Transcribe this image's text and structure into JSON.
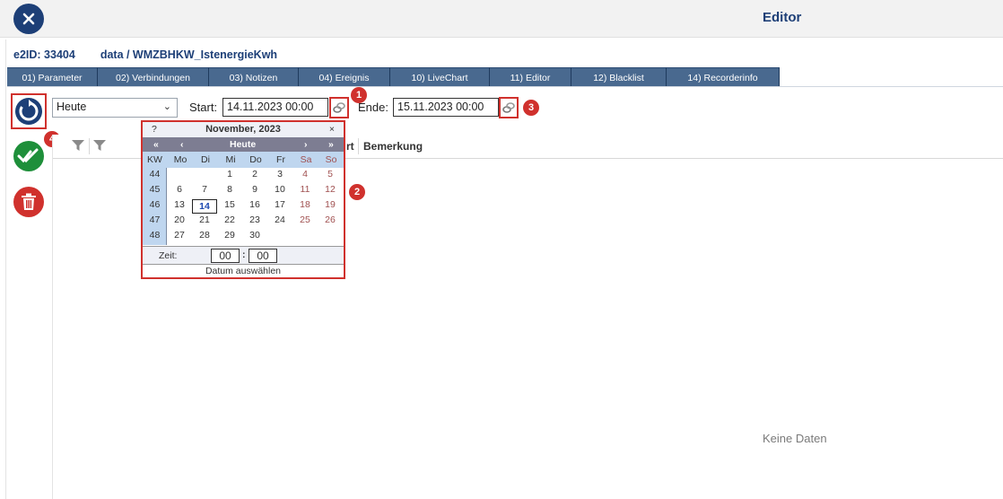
{
  "header": {
    "title": "Editor"
  },
  "info": {
    "e2id": "e2ID: 33404",
    "path": "data / WMZBHKW_IstenergieKwh"
  },
  "tabs": [
    {
      "label": "01) Parameter"
    },
    {
      "label": "02) Verbindungen"
    },
    {
      "label": "03) Notizen"
    },
    {
      "label": "04) Ereignis"
    },
    {
      "label": "10) LiveChart"
    },
    {
      "label": "11) Editor"
    },
    {
      "label": "12) Blacklist"
    },
    {
      "label": "14) Recorderinfo"
    }
  ],
  "toolbar": {
    "range_value": "Heute",
    "start_label": "Start:",
    "start_value": "14.11.2023 00:00",
    "end_label": "Ende:",
    "end_value": "15.11.2023 00:00"
  },
  "badges": {
    "b1": "1",
    "b2": "2",
    "b3": "3",
    "b4": "4"
  },
  "grid": {
    "col_partial": "rt",
    "col_bemerkung": "Bemerkung",
    "empty": "Keine Daten"
  },
  "calendar": {
    "help": "?",
    "title": "November, 2023",
    "close": "×",
    "nav_prev_year": "«",
    "nav_prev_month": "‹",
    "nav_today": "Heute",
    "nav_next_month": "›",
    "nav_next_year": "»",
    "kw_label": "KW",
    "day_names": [
      "Mo",
      "Di",
      "Mi",
      "Do",
      "Fr",
      "Sa",
      "So"
    ],
    "weeks": [
      "44",
      "45",
      "46",
      "47",
      "48"
    ],
    "rows": [
      [
        "",
        "",
        "1",
        "2",
        "3",
        "4",
        "5"
      ],
      [
        "6",
        "7",
        "8",
        "9",
        "10",
        "11",
        "12"
      ],
      [
        "13",
        "14",
        "15",
        "16",
        "17",
        "18",
        "19"
      ],
      [
        "20",
        "21",
        "22",
        "23",
        "24",
        "25",
        "26"
      ],
      [
        "27",
        "28",
        "29",
        "30",
        "",
        "",
        ""
      ]
    ],
    "selected_day": "14",
    "time_label": "Zeit:",
    "hours": "00",
    "minutes": "00",
    "time_sep": ":",
    "footer": "Datum auswählen"
  },
  "colors": {
    "accent": "#1d3f77",
    "tab": "#49698f",
    "highlight": "#d0312d",
    "ok": "#1e8f3a"
  }
}
